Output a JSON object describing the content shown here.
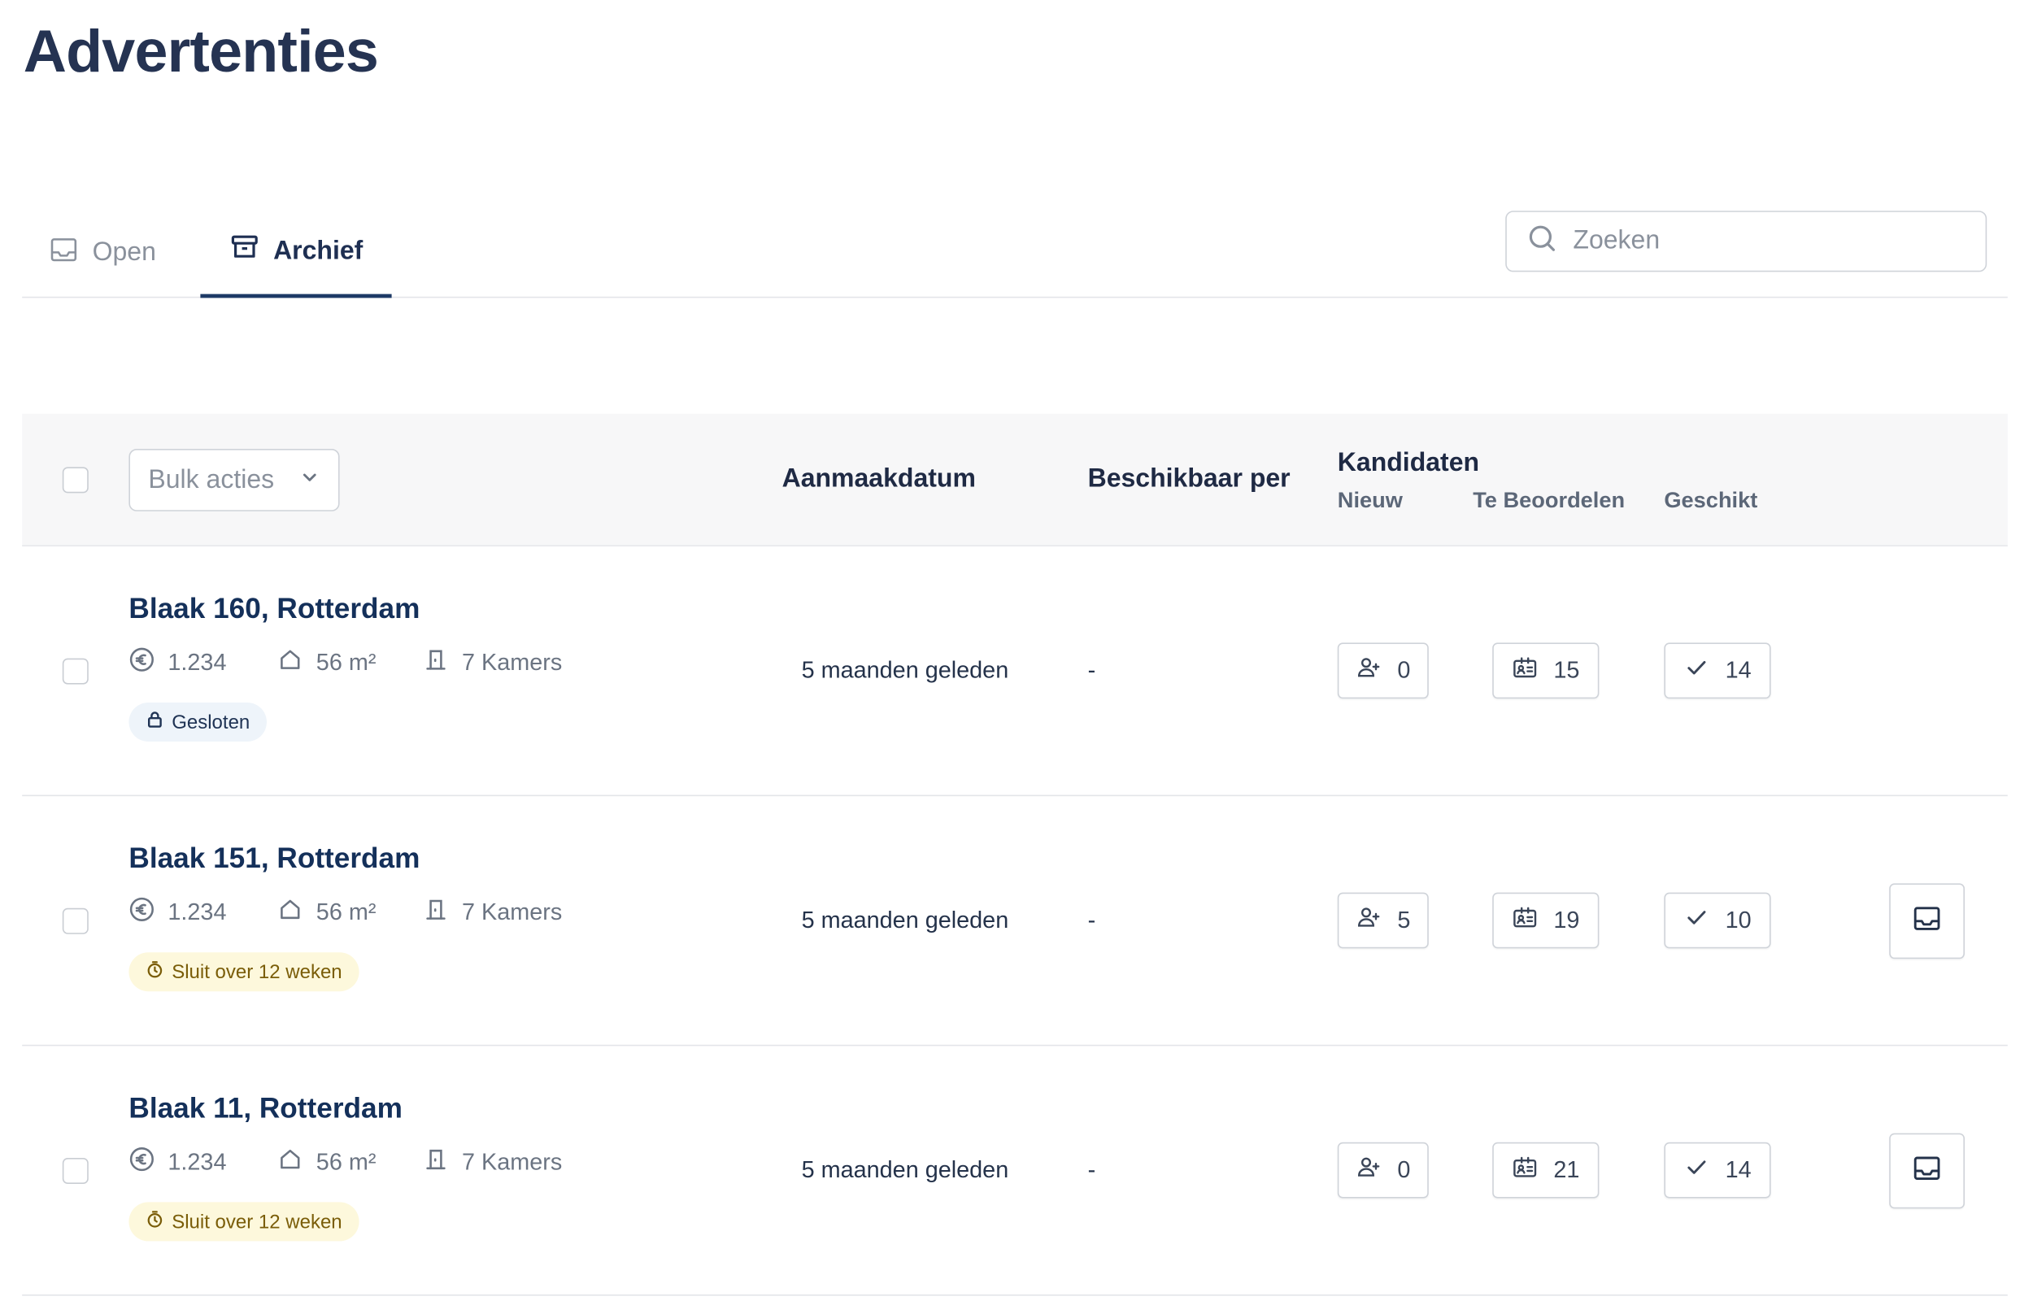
{
  "page": {
    "title": "Advertenties"
  },
  "tabs": {
    "open": "Open",
    "archive": "Archief"
  },
  "search": {
    "placeholder": "Zoeken"
  },
  "table": {
    "bulk_label": "Bulk acties",
    "col_created": "Aanmaakdatum",
    "col_available": "Beschikbaar per",
    "col_candidates": "Kandidaten",
    "col_new": "Nieuw",
    "col_review": "Te Beoordelen",
    "col_suitable": "Geschikt"
  },
  "rows": [
    {
      "title": "Blaak 160, Rotterdam",
      "price": "1.234",
      "area": "56 m²",
      "rooms": "7 Kamers",
      "badge": "Gesloten",
      "badge_type": "closed",
      "created": "5 maanden geleden",
      "available": "-",
      "new": "0",
      "review": "15",
      "suitable": "14",
      "archive_button": false
    },
    {
      "title": "Blaak 151, Rotterdam",
      "price": "1.234",
      "area": "56 m²",
      "rooms": "7 Kamers",
      "badge": "Sluit over 12 weken",
      "badge_type": "warning",
      "created": "5 maanden geleden",
      "available": "-",
      "new": "5",
      "review": "19",
      "suitable": "10",
      "archive_button": true
    },
    {
      "title": "Blaak 11, Rotterdam",
      "price": "1.234",
      "area": "56 m²",
      "rooms": "7 Kamers",
      "badge": "Sluit over 12 weken",
      "badge_type": "warning",
      "created": "5 maanden geleden",
      "available": "-",
      "new": "0",
      "review": "21",
      "suitable": "14",
      "archive_button": true
    }
  ],
  "colors": {
    "primary": "#1e3a66",
    "title": "#14305a",
    "muted": "#8a919c",
    "header_bg": "#f7f7f8",
    "closed_bg": "#eef4fa",
    "warning_bg": "#fdf8dc",
    "warning_text": "#7a5d08"
  },
  "icons": {
    "tab_open": "inbox-icon",
    "tab_archive": "archive-box-icon",
    "search": "search-icon",
    "price": "euro-icon",
    "area": "house-icon",
    "rooms": "door-icon",
    "closed": "lock-icon",
    "warning": "stopwatch-icon",
    "new": "user-plus-icon",
    "review": "id-card-icon",
    "suitable": "check-icon",
    "archive": "inbox-icon"
  }
}
